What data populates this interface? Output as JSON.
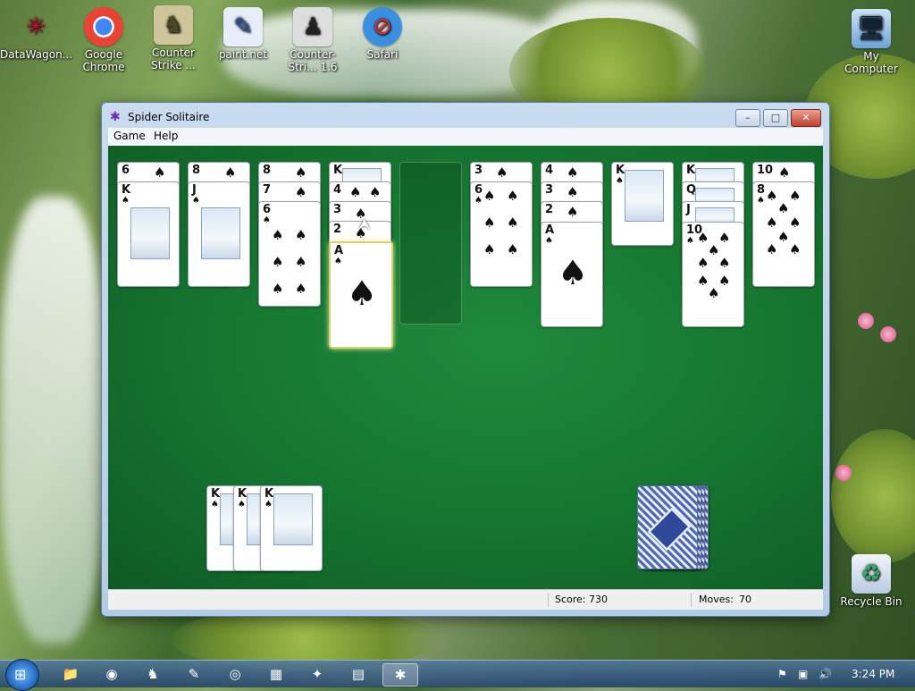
{
  "desktop": {
    "icons": [
      {
        "label": "DataWagon...",
        "icon": "datawagon-icon"
      },
      {
        "label": "Google Chrome",
        "icon": "chrome-icon"
      },
      {
        "label": "Counter Strike ...",
        "icon": "counter-strike-icon"
      },
      {
        "label": "paint.net",
        "icon": "paintnet-icon"
      },
      {
        "label": "Counter-Stri... 1.6",
        "icon": "counter-strike-16-icon"
      },
      {
        "label": "Safari",
        "icon": "safari-icon"
      },
      {
        "label": "My Computer",
        "icon": "my-computer-icon"
      },
      {
        "label": "Recycle Bin",
        "icon": "recycle-bin-icon"
      }
    ]
  },
  "window": {
    "title": "Spider Solitaire",
    "menu": [
      "Game",
      "Help"
    ],
    "status": {
      "score_label": "Score: 730",
      "moves_label": "Moves:",
      "moves_value": "70"
    },
    "colors": {
      "felt": "#15742f"
    }
  },
  "game": {
    "tableau": [
      {
        "cards": [
          "6",
          "K"
        ]
      },
      {
        "cards": [
          "8",
          "J"
        ]
      },
      {
        "cards": [
          "8",
          "7",
          "6"
        ]
      },
      {
        "cards": [
          "K",
          "4",
          "3",
          "2",
          "A"
        ]
      },
      {
        "cards": []
      },
      {
        "cards": [
          "3",
          "6"
        ]
      },
      {
        "cards": [
          "4",
          "3",
          "2",
          "A"
        ]
      },
      {
        "cards": [
          "K"
        ]
      },
      {
        "cards": [
          "K",
          "Q",
          "J",
          "10"
        ]
      },
      {
        "cards": [
          "10",
          "8"
        ]
      }
    ],
    "completed_sets": [
      "K",
      "K",
      "K"
    ],
    "stock_piles": 4
  },
  "taskbar": {
    "clock": "3:24 PM",
    "apps": [
      "explorer-icon",
      "chrome-icon",
      "counter-strike-icon",
      "paintnet-icon",
      "disk-icon",
      "media-icon",
      "app-icon",
      "notepad-icon",
      "spider-solitaire-icon"
    ]
  }
}
